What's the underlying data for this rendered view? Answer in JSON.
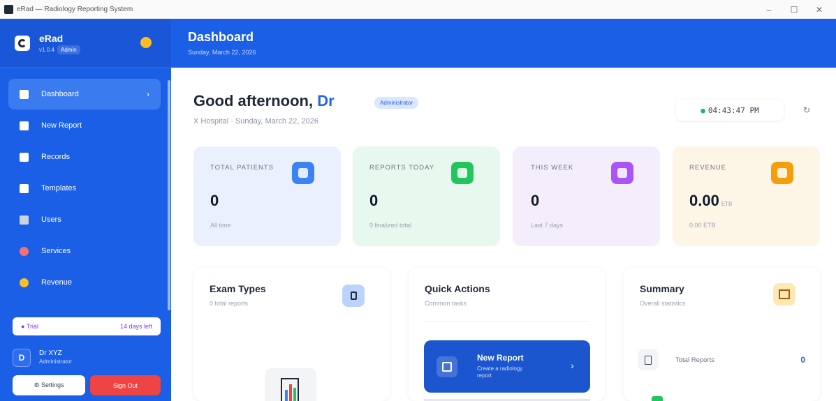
{
  "window": {
    "title": "eRad — Radiology Reporting System",
    "controls": [
      "–",
      "☐",
      "✕"
    ]
  },
  "sidebar": {
    "brand": {
      "name": "eRad",
      "version": "v1.0.4",
      "role": "Admin"
    },
    "items": [
      {
        "label": "Dashboard",
        "icon": "chart-icon",
        "active": true
      },
      {
        "label": "New Report",
        "icon": "document-icon"
      },
      {
        "label": "Records",
        "icon": "folder-icon"
      },
      {
        "label": "Templates",
        "icon": "template-icon"
      },
      {
        "label": "Users",
        "icon": "users-icon"
      },
      {
        "label": "Services",
        "icon": "pill-icon"
      },
      {
        "label": "Revenue",
        "icon": "money-bag-icon"
      }
    ],
    "trial": {
      "label": "● Trial",
      "remaining": "14 days left"
    },
    "user": {
      "initial": "D",
      "name": "Dr XYZ",
      "role": "Administrator"
    },
    "settings_label": "⚙ Settings",
    "signout_label": "Sign Out"
  },
  "header": {
    "title": "Dashboard",
    "date": "Sunday, March 22, 2026"
  },
  "main": {
    "greeting": "Good afternoon, ",
    "greeting_name": "Dr",
    "role_badge": "Administrator",
    "subtitle": "X Hospital · Sunday, March 22, 2026",
    "clock": "04:43:47 PM",
    "clock_dot": "●",
    "refresh_icon": "↻",
    "stats": [
      {
        "label": "TOTAL PATIENTS",
        "value": "0",
        "caption": "All time",
        "icon": "patients-icon",
        "color": "#3b82f6"
      },
      {
        "label": "REPORTS TODAY",
        "value": "0",
        "caption": "0 finalized total",
        "icon": "clipboard-icon",
        "color": "#22c55e"
      },
      {
        "label": "THIS WEEK",
        "value": "0",
        "caption": "Last 7 days",
        "icon": "calendar-icon",
        "color": "#a855f7"
      },
      {
        "label": "REVENUE",
        "value": "0.00",
        "unit": "ETB",
        "caption": "0.00 ETB",
        "icon": "money-bag-icon",
        "color": "#f59e0b"
      }
    ],
    "cards": {
      "exam_types": {
        "title": "Exam Types",
        "subtitle": "0 total reports"
      },
      "quick_actions": {
        "title": "Quick Actions",
        "subtitle": "Common tasks",
        "new_report": {
          "title": "New Report",
          "subtitle": "Create a radiology report",
          "chevron": "›"
        }
      },
      "summary": {
        "title": "Summary",
        "subtitle": "Overall statistics",
        "rows": [
          {
            "label": "Total Reports",
            "value": "0"
          }
        ]
      }
    }
  }
}
